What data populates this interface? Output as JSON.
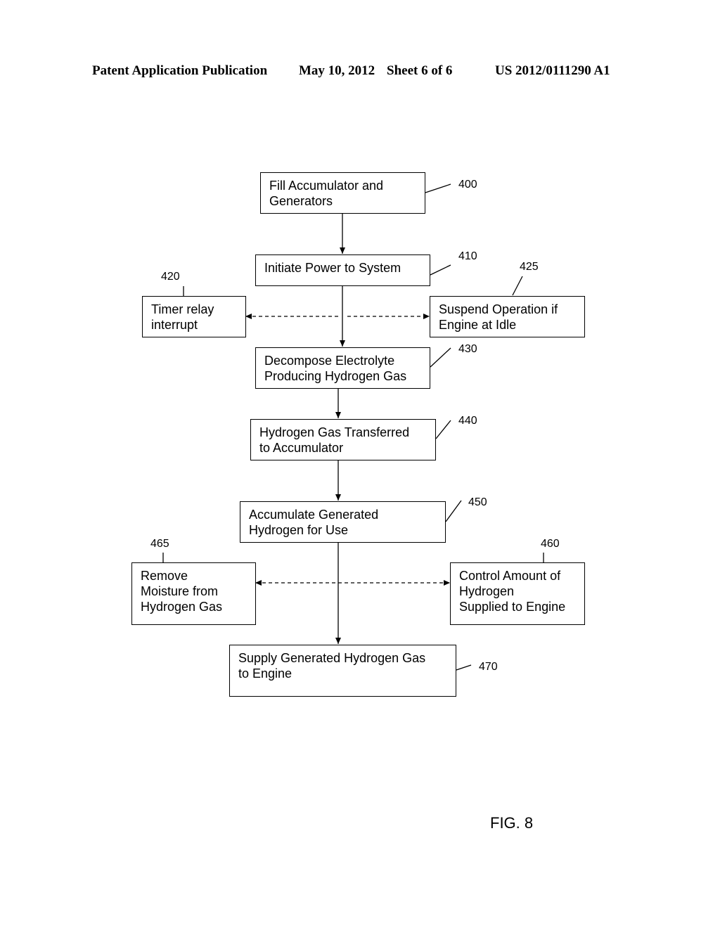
{
  "header": {
    "left": "Patent Application Publication",
    "date": "May 10, 2012",
    "sheet": "Sheet 6 of 6",
    "number": "US 2012/0111290 A1"
  },
  "figure_label": "FIG. 8",
  "steps": {
    "s400": {
      "ref": "400",
      "lines": [
        "Fill Accumulator and",
        "Generators"
      ]
    },
    "s410": {
      "ref": "410",
      "lines": [
        "Initiate Power to System"
      ]
    },
    "s420": {
      "ref": "420",
      "lines": [
        "Timer relay",
        "interrupt"
      ]
    },
    "s425": {
      "ref": "425",
      "lines": [
        "Suspend Operation if",
        "Engine at Idle"
      ]
    },
    "s430": {
      "ref": "430",
      "lines": [
        "Decompose Electrolyte",
        "Producing Hydrogen Gas"
      ]
    },
    "s440": {
      "ref": "440",
      "lines": [
        "Hydrogen Gas Transferred",
        "to Accumulator"
      ]
    },
    "s450": {
      "ref": "450",
      "lines": [
        "Accumulate Generated",
        "Hydrogen for Use"
      ]
    },
    "s465": {
      "ref": "465",
      "lines": [
        "Remove",
        "Moisture from",
        "Hydrogen Gas"
      ]
    },
    "s460": {
      "ref": "460",
      "lines": [
        "Control Amount of",
        "Hydrogen",
        "Supplied to Engine"
      ]
    },
    "s470": {
      "ref": "470",
      "lines": [
        "Supply Generated Hydrogen Gas",
        "to Engine"
      ]
    }
  }
}
